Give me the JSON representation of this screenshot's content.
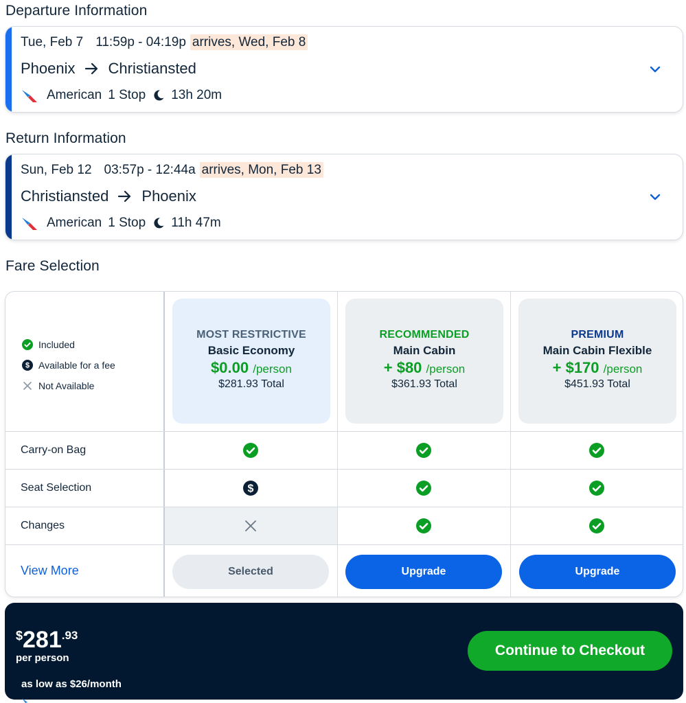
{
  "departure": {
    "section_title": "Departure Information",
    "date": "Tue, Feb 7",
    "time": "11:59p - 04:19p",
    "arrives": "arrives, Wed, Feb 8",
    "origin": "Phoenix",
    "destination": "Christiansted",
    "airline": "American",
    "stops": "1 Stop",
    "duration": "13h 20m",
    "accent_color": "#1a6ff0"
  },
  "return": {
    "section_title": "Return Information",
    "date": "Sun, Feb 12",
    "time": "03:57p - 12:44a",
    "arrives": "arrives, Mon, Feb 13",
    "origin": "Christiansted",
    "destination": "Phoenix",
    "airline": "American",
    "stops": "1 Stop",
    "duration": "11h 47m",
    "accent_color": "#0b3a8c"
  },
  "fare_selection": {
    "section_title": "Fare Selection",
    "legend": {
      "included": "Included",
      "fee": "Available for a fee",
      "not_available": "Not Available"
    },
    "fares": [
      {
        "tag": "MOST RESTRICTIVE",
        "name": "Basic Economy",
        "price": "$0.00",
        "per": "/person",
        "total": "$281.93 Total",
        "button": "Selected",
        "tag_color": "#4a6178",
        "box_color": "#e6f0fc"
      },
      {
        "tag": "RECOMMENDED",
        "name": "Main Cabin",
        "price": "+ $80",
        "per": "/person",
        "total": "$361.93 Total",
        "button": "Upgrade",
        "tag_color": "#0a9e24",
        "box_color": "#eceff2"
      },
      {
        "tag": "PREMIUM",
        "name": "Main Cabin Flexible",
        "price": "+ $170",
        "per": "/person",
        "total": "$451.93 Total",
        "button": "Upgrade",
        "tag_color": "#0b3a8c",
        "box_color": "#eceff2"
      }
    ],
    "features": [
      {
        "label": "Carry-on Bag",
        "values": [
          "included",
          "included",
          "included"
        ]
      },
      {
        "label": "Seat Selection",
        "values": [
          "fee",
          "included",
          "included"
        ]
      },
      {
        "label": "Changes",
        "values": [
          "not_available",
          "included",
          "included"
        ]
      }
    ],
    "view_more": "View More"
  },
  "footer": {
    "currency": "$",
    "dollars": "281",
    "cents": ".93",
    "per_person": "per person",
    "monthly": "as low as $26/month",
    "checkout": "Continue to Checkout"
  }
}
